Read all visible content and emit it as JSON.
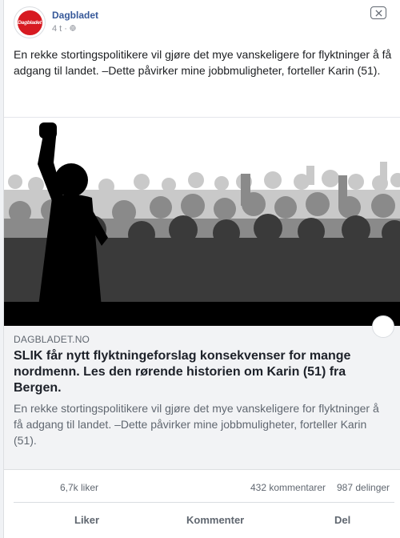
{
  "post": {
    "page_name": "Dagbladet",
    "avatar_text": "Dagbladet",
    "time": "4 t",
    "separator": "·",
    "privacy_icon": "globe-icon",
    "close_icon": "close-icon",
    "text": "En rekke stortingspolitikere vil gjøre det mye vanskeligere for flyktninger å få adgang til landet. –Dette påvirker mine jobbmuligheter, forteller Karin (51)."
  },
  "link": {
    "image_icon": "crowd-silhouette-image",
    "domain": "DAGBLADET.NO",
    "title": "SLIK får nytt flyktningeforslag konsekvenser for mange nordmenn. Les den rørende historien om Karin (51) fra Bergen.",
    "description": "En rekke stortingspolitikere vil gjøre det mye vanskeligere for flyktninger å få adgang til landet. –Dette påvirker mine jobbmuligheter, forteller Karin (51)."
  },
  "stats": {
    "likes": "6,7k liker",
    "comments": "432 kommentarer",
    "shares": "987 delinger"
  },
  "actions": {
    "like": "Liker",
    "comment": "Kommenter",
    "share": "Del"
  },
  "colors": {
    "brand_red": "#d71a21",
    "link_blue": "#365899",
    "muted": "#606770"
  }
}
